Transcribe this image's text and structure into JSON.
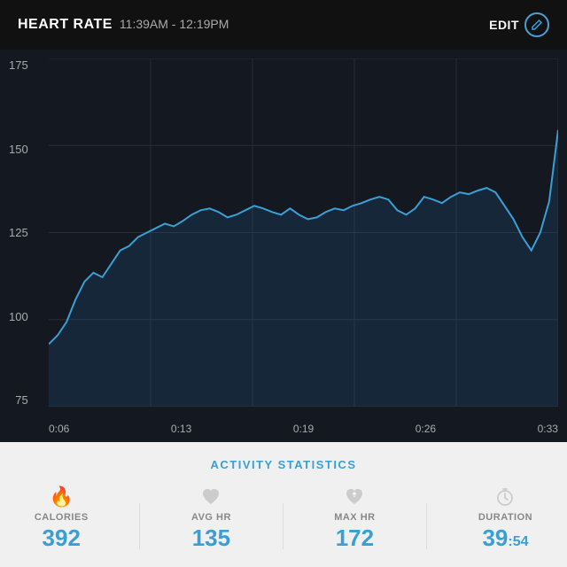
{
  "header": {
    "title": "HEART RATE",
    "time_range": "11:39AM - 12:19PM",
    "edit_label": "EDIT"
  },
  "chart": {
    "y_labels": [
      "175",
      "150",
      "125",
      "100",
      "75"
    ],
    "x_labels": [
      "0:06",
      "0:13",
      "0:19",
      "0:26",
      "0:33"
    ],
    "grid_rows": 4,
    "accent_color": "#3a9fd4"
  },
  "stats": {
    "title": "ACTIVITY STATISTICS",
    "items": [
      {
        "icon": "🔥",
        "label": "CALORIES",
        "value": "392",
        "value_sub": ""
      },
      {
        "icon": "♥",
        "label": "AVG HR",
        "value": "135",
        "value_sub": ""
      },
      {
        "icon": "♥",
        "label": "MAX HR",
        "value": "172",
        "value_sub": ""
      },
      {
        "icon": "⏱",
        "label": "DURATION",
        "value": "39",
        "value_sub": ":54"
      }
    ]
  }
}
